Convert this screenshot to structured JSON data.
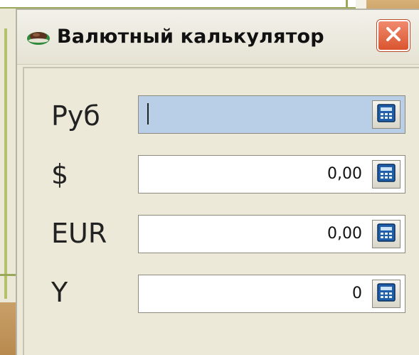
{
  "window": {
    "title": "Валютный калькулятор",
    "close_icon": "close-icon",
    "app_icon": "currency-calculator-icon"
  },
  "fields": [
    {
      "label": "Руб",
      "value": "",
      "active": true,
      "icon": "calculator-icon"
    },
    {
      "label": "$",
      "value": "0,00",
      "active": false,
      "icon": "calculator-icon"
    },
    {
      "label": "EUR",
      "value": "0,00",
      "active": false,
      "icon": "calculator-icon"
    },
    {
      "label": "Y",
      "value": "0",
      "active": false,
      "icon": "calculator-icon"
    }
  ],
  "colors": {
    "active_field": "#b9cfe7",
    "close_button": "#d9552f",
    "window_bg": "#ece9d8"
  }
}
